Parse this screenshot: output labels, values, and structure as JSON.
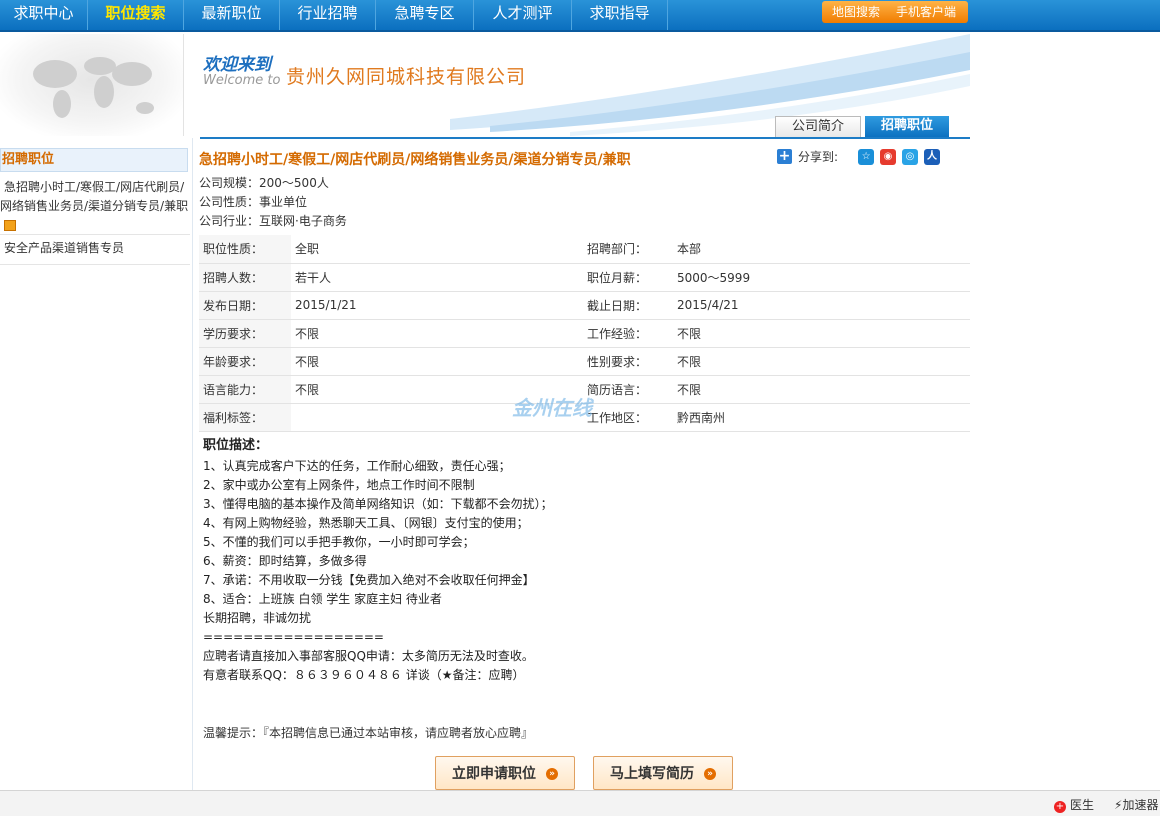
{
  "nav": {
    "items": [
      "求职中心",
      "职位搜索",
      "最新职位",
      "行业招聘",
      "急聘专区",
      "人才测评",
      "求职指导"
    ],
    "active_index": 1,
    "right_links": [
      "地图搜索",
      "手机客户端"
    ]
  },
  "banner": {
    "welcome_cn": "欢迎来到",
    "welcome_en": "Welcome to",
    "company_name": "贵州久网同城科技有限公司"
  },
  "tabs": {
    "intro": "公司简介",
    "jobs": "招聘职位"
  },
  "sidebar": {
    "heading": "招聘职位",
    "items": [
      "急招聘小时工/寒假工/网店代刷员/网络销售业务员/渠道分销专员/兼职",
      "安全产品渠道销售专员"
    ]
  },
  "job": {
    "title": "急招聘小时工/寒假工/网店代刷员/网络销售业务员/渠道分销专员/兼职",
    "share_label": "分享到:",
    "company_info": [
      {
        "label": "公司规模：",
        "value": "200～500人"
      },
      {
        "label": "公司性质：",
        "value": "事业单位"
      },
      {
        "label": "公司行业：",
        "value": "互联网·电子商务"
      }
    ],
    "rows": [
      [
        {
          "label": "职位性质：",
          "value": "全职"
        },
        {
          "label": "招聘部门：",
          "value": "本部"
        }
      ],
      [
        {
          "label": "招聘人数：",
          "value": "若干人"
        },
        {
          "label": "职位月薪：",
          "value": "5000～5999"
        }
      ],
      [
        {
          "label": "发布日期：",
          "value": "2015/1/21"
        },
        {
          "label": "截止日期：",
          "value": "2015/4/21"
        }
      ],
      [
        {
          "label": "学历要求：",
          "value": "不限"
        },
        {
          "label": "工作经验：",
          "value": "不限"
        }
      ],
      [
        {
          "label": "年龄要求：",
          "value": "不限"
        },
        {
          "label": "性别要求：",
          "value": "不限"
        }
      ],
      [
        {
          "label": "语言能力：",
          "value": "不限"
        },
        {
          "label": "简历语言：",
          "value": "不限"
        }
      ],
      [
        {
          "label": "福利标签：",
          "value": ""
        },
        {
          "label": "工作地区：",
          "value": "黔西南州"
        }
      ]
    ],
    "desc_title": "职位描述：",
    "desc_lines": [
      "1、认真完成客户下达的任务，工作耐心细致，责任心强；",
      "2、家中或办公室有上网条件，地点工作时间不限制",
      "3、懂得电脑的基本操作及简单网络知识（如：下载都不会勿扰）；",
      "4、有网上购物经验，熟悉聊天工具、〔网银〕支付宝的使用；",
      "5、不懂的我们可以手把手教你，一小时即可学会；",
      "6、薪资：即时结算，多做多得",
      "7、承诺：不用收取一分钱【免费加入绝对不会收取任何押金】",
      "8、适合：上班族 白领 学生 家庭主妇 待业者",
      "长期招聘，非诚勿扰",
      "==================",
      "应聘者请直接加入事部客服QQ申请：太多简历无法及时查收。",
      "有意者联系QQ：８６３９６０４８６ 详谈（★备注：应聘）"
    ],
    "tip": "温馨提示：『本招聘信息已通过本站审核，请应聘者放心应聘』",
    "apply_button": "立即申请职位",
    "resume_button": "马上填写简历"
  },
  "watermark": "金州在线",
  "statusbar": {
    "doctor": "医生",
    "speed": "加速器"
  }
}
